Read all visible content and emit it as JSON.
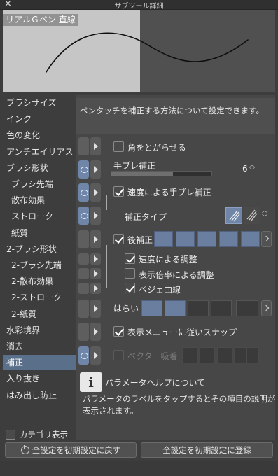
{
  "window": {
    "title": "サブツール詳細",
    "close_glyph": "×"
  },
  "preview": {
    "label": "リアルＧペン 直線"
  },
  "categories": [
    {
      "label": "ブラシサイズ",
      "sub": false,
      "selected": false
    },
    {
      "label": "インク",
      "sub": false,
      "selected": false
    },
    {
      "label": "色の変化",
      "sub": false,
      "selected": false
    },
    {
      "label": "アンチエイリアス",
      "sub": false,
      "selected": false
    },
    {
      "label": "ブラシ形状",
      "sub": false,
      "selected": false
    },
    {
      "label": "ブラシ先端",
      "sub": true,
      "selected": false
    },
    {
      "label": "散布効果",
      "sub": true,
      "selected": false
    },
    {
      "label": "ストローク",
      "sub": true,
      "selected": false
    },
    {
      "label": "紙質",
      "sub": true,
      "selected": false
    },
    {
      "label": "2-ブラシ形状",
      "sub": false,
      "selected": false
    },
    {
      "label": "2-ブラシ先端",
      "sub": true,
      "selected": false
    },
    {
      "label": "2-散布効果",
      "sub": true,
      "selected": false
    },
    {
      "label": "2-ストローク",
      "sub": true,
      "selected": false
    },
    {
      "label": "2-紙質",
      "sub": true,
      "selected": false
    },
    {
      "label": "水彩境界",
      "sub": false,
      "selected": false
    },
    {
      "label": "消去",
      "sub": false,
      "selected": false
    },
    {
      "label": "補正",
      "sub": false,
      "selected": true
    },
    {
      "label": "入り抜き",
      "sub": false,
      "selected": false
    },
    {
      "label": "はみ出し防止",
      "sub": false,
      "selected": false
    }
  ],
  "description": "ペンタッチを補正する方法について設定できます。",
  "settings": {
    "corner": {
      "label": "角をとがらせる",
      "checked": false
    },
    "stabilization": {
      "label": "手ブレ補正",
      "value": "6",
      "level": 0.6
    },
    "speed_stab": {
      "label": "速度による手ブレ補正",
      "checked": true
    },
    "correction_type": {
      "label": "補正タイプ"
    },
    "post_correction": {
      "label": "後補正",
      "checked": true,
      "filled_blocks": 5
    },
    "speed_adjust": {
      "label": "速度による調整",
      "checked": true
    },
    "zoom_adjust": {
      "label": "表示倍率による調整",
      "checked": false
    },
    "bezier": {
      "label": "ベジェ曲線",
      "checked": true
    },
    "harai": {
      "label": "はらい",
      "filled_blocks": 2
    },
    "snap": {
      "label": "表示メニューに従いスナップ",
      "checked": true
    },
    "vector": {
      "label": "ベクター吸着",
      "checked": false,
      "disabled": true
    }
  },
  "help": {
    "title": "パラメータヘルプについて",
    "body": "パラメータのラベルをタップするとその項目の説明が表示されます。"
  },
  "category_display": {
    "label": "カテゴリ表示",
    "checked": false
  },
  "buttons": {
    "reset": "全設定を初期設定に戻す",
    "register": "全設定を初期設定に登録"
  },
  "colors": {
    "accent": "#6a7e9f",
    "selected": "#5a6f8a"
  }
}
